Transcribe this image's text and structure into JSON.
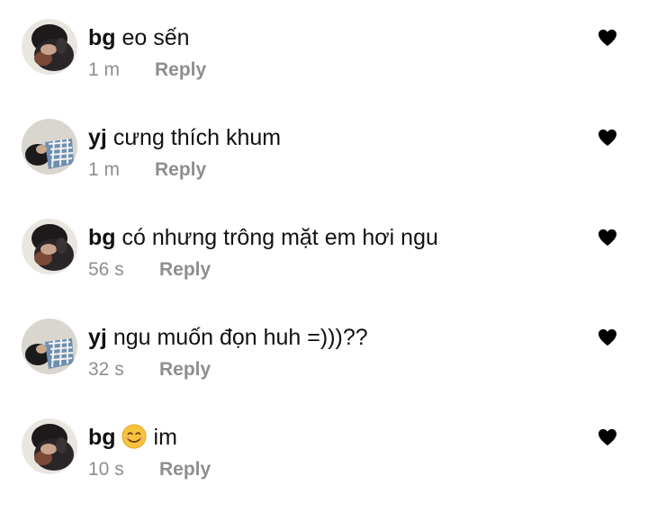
{
  "comments": [
    {
      "username": "bg",
      "text": "eo sến",
      "time": "1 m",
      "reply_label": "Reply",
      "avatar_icon": "avatar-bg",
      "liked_icon": "heart-filled-icon"
    },
    {
      "username": "yj",
      "text": "cưng thích khum",
      "time": "1 m",
      "reply_label": "Reply",
      "avatar_icon": "avatar-yj",
      "liked_icon": "heart-filled-icon"
    },
    {
      "username": "bg",
      "text": "có nhưng trông mặt em hơi ngu",
      "time": "56 s",
      "reply_label": "Reply",
      "avatar_icon": "avatar-bg",
      "liked_icon": "heart-filled-icon"
    },
    {
      "username": "yj",
      "text": "ngu muốn đọn huh =)))??",
      "time": "32 s",
      "reply_label": "Reply",
      "avatar_icon": "avatar-yj",
      "liked_icon": "heart-filled-icon"
    },
    {
      "username": "bg",
      "emoji": "smiling-face-emoji",
      "text": "im",
      "time": "10 s",
      "reply_label": "Reply",
      "avatar_icon": "avatar-bg",
      "liked_icon": "heart-filled-icon"
    }
  ],
  "colors": {
    "text": "#111111",
    "meta": "#8e8e8e",
    "heart": "#000000",
    "background": "#ffffff"
  }
}
